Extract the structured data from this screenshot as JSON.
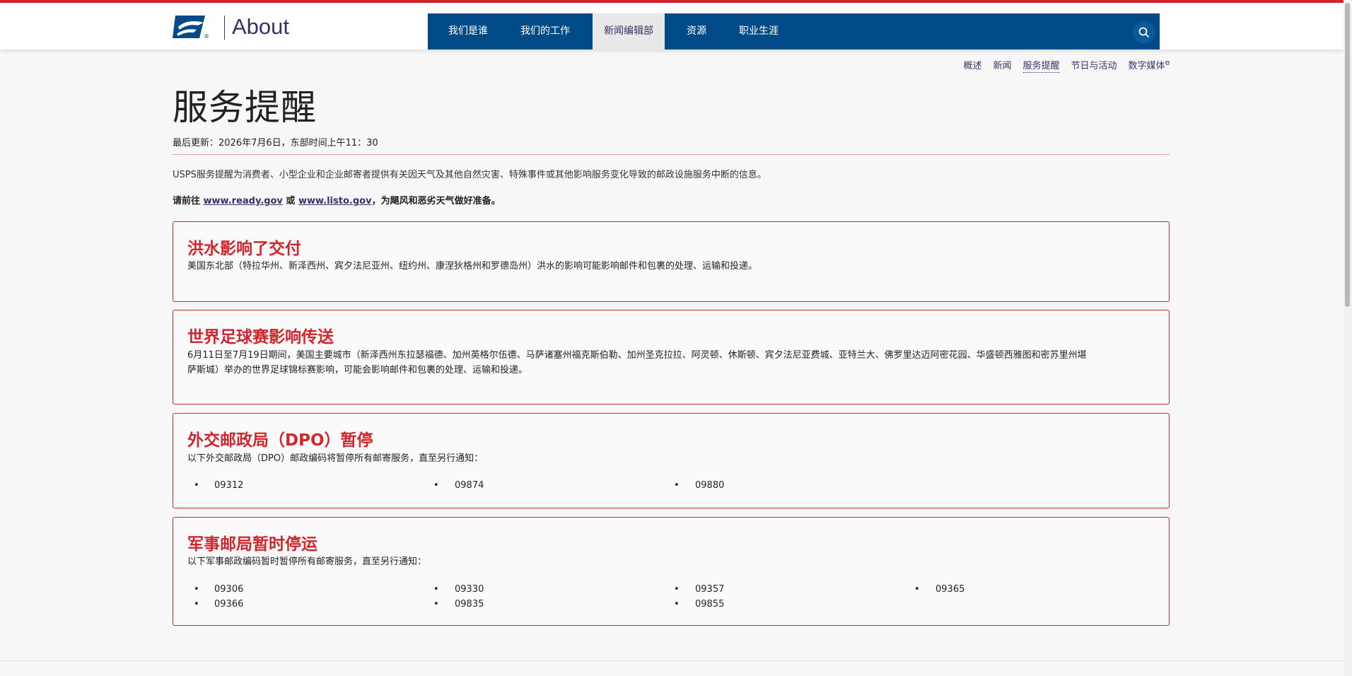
{
  "brand": {
    "about": "About",
    "red_bar_color": "#d1262b",
    "nav_color": "#004b87"
  },
  "nav": {
    "items": [
      {
        "label": "我们是谁"
      },
      {
        "label": "我们的工作"
      },
      {
        "label": "新闻编辑部"
      },
      {
        "label": "资源"
      },
      {
        "label": "职业生涯"
      }
    ],
    "search_icon": "search-icon"
  },
  "subnav": {
    "items": [
      {
        "label": "概述"
      },
      {
        "label": "新闻"
      },
      {
        "label": "服务提醒"
      },
      {
        "label": "节日与活动"
      },
      {
        "label": "数字媒体"
      }
    ]
  },
  "page": {
    "title": "服务提醒",
    "updated": "最后更新：2026年7月6日，东部时间上午11：30",
    "intro": "USPS服务提醒为消费者、小型企业和企业邮寄者提供有关因天气及其他自然灾害、特殊事件或其他影响服务变化导致的邮政设施服务中断的信息。",
    "prep_prefix": "请前往 ",
    "prep_link1": "www.ready.gov",
    "prep_mid": " 或 ",
    "prep_link2": "www.listo.gov",
    "prep_suffix": "，为飓风和恶劣天气做好准备。"
  },
  "alerts": [
    {
      "title": "洪水影响了交付",
      "body": "美国东北部（特拉华州、新泽西州、宾夕法尼亚州、纽约州、康涅狄格州和罗德岛州）洪水的影响可能影响邮件和包裹的处理、运输和投递。"
    },
    {
      "title": "世界足球赛影响传送",
      "body_line1": "6月11日至7月19日期间，美国主要城市（新泽西州东拉瑟福德、加州英格尔伍德、马萨诸塞州福克斯伯勒、加州圣克拉拉、阿灵顿、休斯顿、宾夕法尼亚费城、亚特兰大、佛罗里达迈阿密花园、华盛顿西雅图和密苏里州堪",
      "body_line2": "萨斯城）举办的世界足球锦标赛影响，可能会影响邮件和包裹的处理、运输和投递。"
    },
    {
      "title": "外交邮政局（DPO）暂停",
      "body": "以下外交邮政局（DPO）邮政编码将暂停所有邮寄服务，直至另行通知：",
      "codes": [
        "09312",
        "09874",
        "09880"
      ]
    },
    {
      "title": "军事邮局暂时停运",
      "body": "以下军事邮政编码暂时暂停所有邮寄服务，直至另行通知：",
      "codes": [
        "09306",
        "09330",
        "09357",
        "09365",
        "09366",
        "09835",
        "09855"
      ]
    }
  ]
}
